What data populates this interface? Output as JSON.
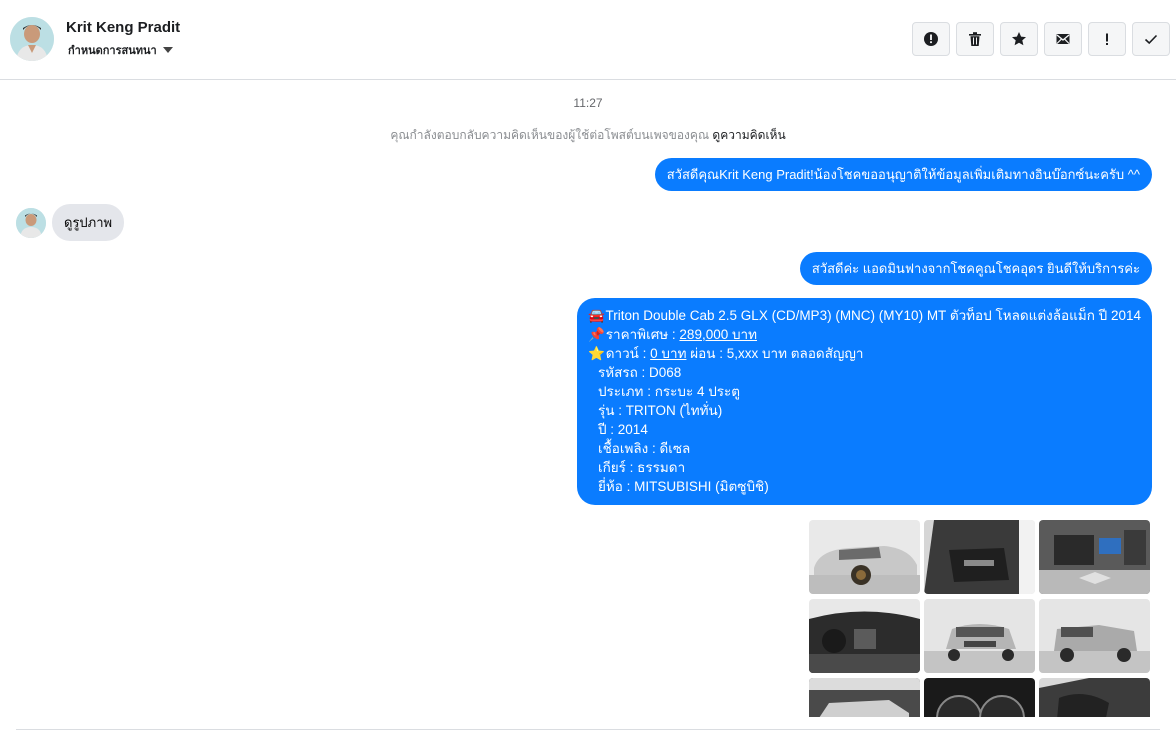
{
  "header": {
    "contact_name": "Krit Keng Pradit",
    "assign_label": "กำหนดการสนทนา",
    "toolbar": [
      {
        "name": "spam-button",
        "icon": "alert-circle-icon"
      },
      {
        "name": "delete-button",
        "icon": "trash-icon"
      },
      {
        "name": "star-button",
        "icon": "star-icon"
      },
      {
        "name": "mark-unread-button",
        "icon": "envelope-icon"
      },
      {
        "name": "priority-button",
        "icon": "exclamation-icon"
      },
      {
        "name": "done-button",
        "icon": "check-icon"
      }
    ]
  },
  "thread": {
    "timestamp": "11:27",
    "context_text": "คุณกำลังตอบกลับความคิดเห็นของผู้ใช้ต่อโพสต์บนเพจของคุณ",
    "context_link": "ดูความคิดเห็น",
    "messages": {
      "m1": "สวัสดีคุณKrit Keng Pradit!น้องโชคขออนุญาติให้ข้อมูลเพิ่มเติมทางอินบ๊อกซ์นะครับ ^^",
      "m2": "ดูรูปภาพ",
      "m3": "สวัสดีค่ะ แอดมินฟางจากโชคคูณโชคอุดร ยินดีให้บริการค่ะ",
      "m4": {
        "title": "Triton Double Cab 2.5 GLX (CD/MP3) (MNC) (MY10) MT ตัวท็อป โหลดแต่งล้อแม็ก ปี 2014",
        "price_label": "ราคาพิเศษ : ",
        "price_value": "289,000 บาท",
        "down_label": "ดาวน์ : ",
        "down_value": "0 บาท",
        "installment": " ผ่อน : 5,xxx บาท ตลอดสัญญา",
        "code": "รหัสรถ : D068",
        "type": "ประเภท : กระบะ 4 ประตู",
        "model": "รุ่น : TRITON (ไททั่น)",
        "year": "ปี : 2014",
        "fuel": "เชื้อเพลิง : ดีเซล",
        "gear": "เกียร์ : ธรรมดา",
        "brand": "ยี่ห้อ : MITSUBISHI (มิตซูบิชิ)"
      }
    },
    "emoji": {
      "car": "🚘",
      "pin": "📌",
      "star": "⭐"
    },
    "gallery": [
      {
        "name": "photo-car-side"
      },
      {
        "name": "photo-door-interior"
      },
      {
        "name": "photo-engine"
      },
      {
        "name": "photo-dashboard"
      },
      {
        "name": "photo-front-view"
      },
      {
        "name": "photo-rear-view"
      },
      {
        "name": "photo-side-view-2"
      },
      {
        "name": "photo-gauges"
      },
      {
        "name": "photo-seat-interior"
      }
    ]
  },
  "colors": {
    "outgoing_bubble": "#0a7cff",
    "incoming_bubble": "#e4e6eb",
    "border": "#dadde1"
  }
}
